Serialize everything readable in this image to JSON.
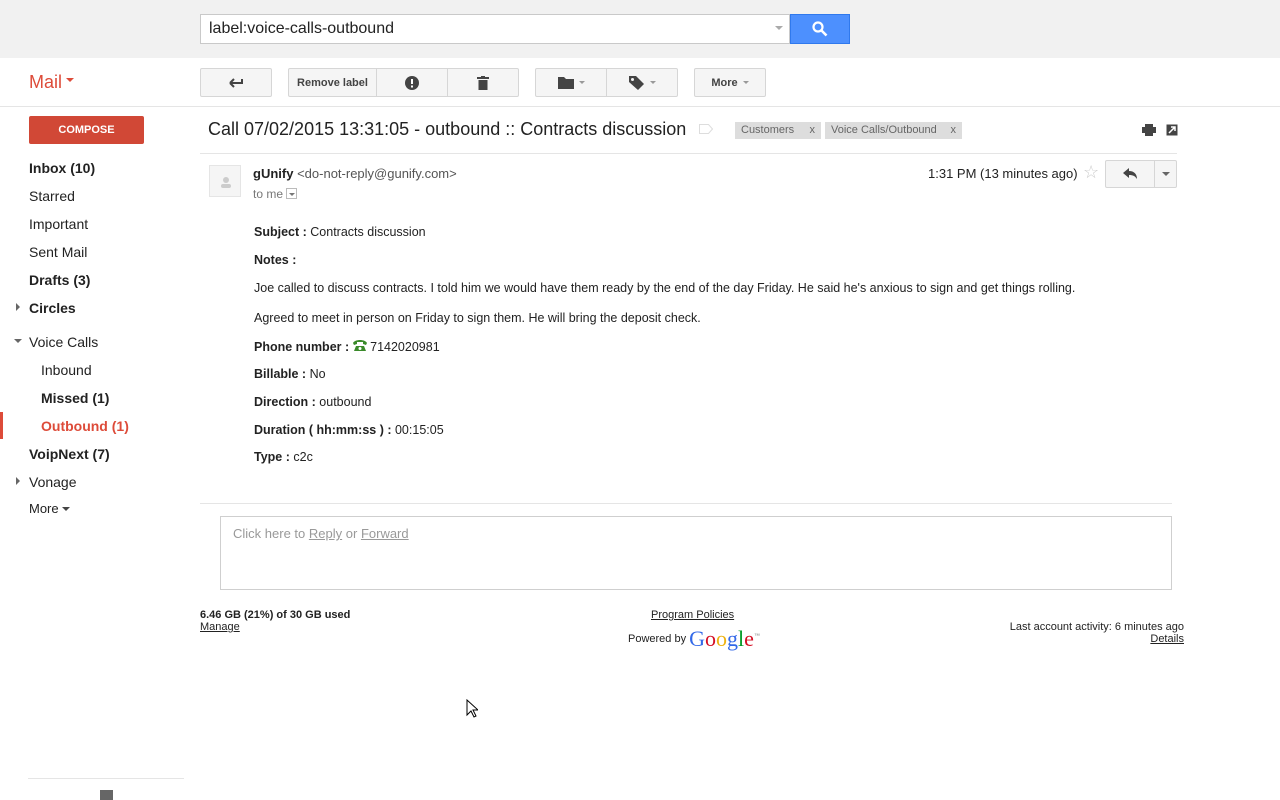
{
  "search": {
    "value": "label:voice-calls-outbound"
  },
  "app": {
    "name": "Mail"
  },
  "toolbar": {
    "remove_label": "Remove label",
    "more": "More"
  },
  "sidebar": {
    "compose": "COMPOSE",
    "items": [
      {
        "label": "Inbox (10)"
      },
      {
        "label": "Starred"
      },
      {
        "label": "Important"
      },
      {
        "label": "Sent Mail"
      },
      {
        "label": "Drafts (3)"
      },
      {
        "label": "Circles"
      },
      {
        "label": "Voice Calls"
      },
      {
        "label": "Inbound"
      },
      {
        "label": "Missed (1)"
      },
      {
        "label": "Outbound (1)"
      },
      {
        "label": "VoipNext (7)"
      },
      {
        "label": "Vonage"
      },
      {
        "label": "More"
      }
    ]
  },
  "message": {
    "subject": "Call 07/02/2015 13:31:05 - outbound :: Contracts discussion",
    "labels": [
      {
        "name": "Customers",
        "remove": "x"
      },
      {
        "name": "Voice Calls/Outbound",
        "remove": "x"
      }
    ],
    "sender_name": "gUnify",
    "sender_email": "<do-not-reply@gunify.com>",
    "to": "to me",
    "time": "1:31 PM (13 minutes ago)",
    "fields": {
      "subject_label": "Subject :",
      "subject_value": "Contracts discussion",
      "notes_label": "Notes :",
      "notes_1": "Joe called to discuss contracts. I told him we would have them ready by the end of the day Friday. He said he's anxious to sign and get things rolling.",
      "notes_2": "Agreed to meet in person on Friday to sign them. He will bring the deposit check.",
      "phone_label": "Phone number :",
      "phone_value": "7142020981",
      "billable_label": "Billable :",
      "billable_value": "No",
      "direction_label": "Direction :",
      "direction_value": "outbound",
      "duration_label": "Duration ( hh:mm:ss ) :",
      "duration_value": "00:15:05",
      "type_label": "Type :",
      "type_value": "c2c"
    }
  },
  "reply": {
    "prefix": "Click here to",
    "reply": "Reply",
    "or": "or",
    "forward": "Forward"
  },
  "footer": {
    "storage": "6.46 GB (21%) of 30 GB used",
    "manage": "Manage",
    "policies": "Program Policies",
    "powered": "Powered by",
    "google": "Google",
    "activity": "Last account activity: 6 minutes ago",
    "details": "Details"
  },
  "colors": {
    "accent": "#dd4b39",
    "search_button": "#4d90fe",
    "phone_icon": "#3a8a2a"
  }
}
